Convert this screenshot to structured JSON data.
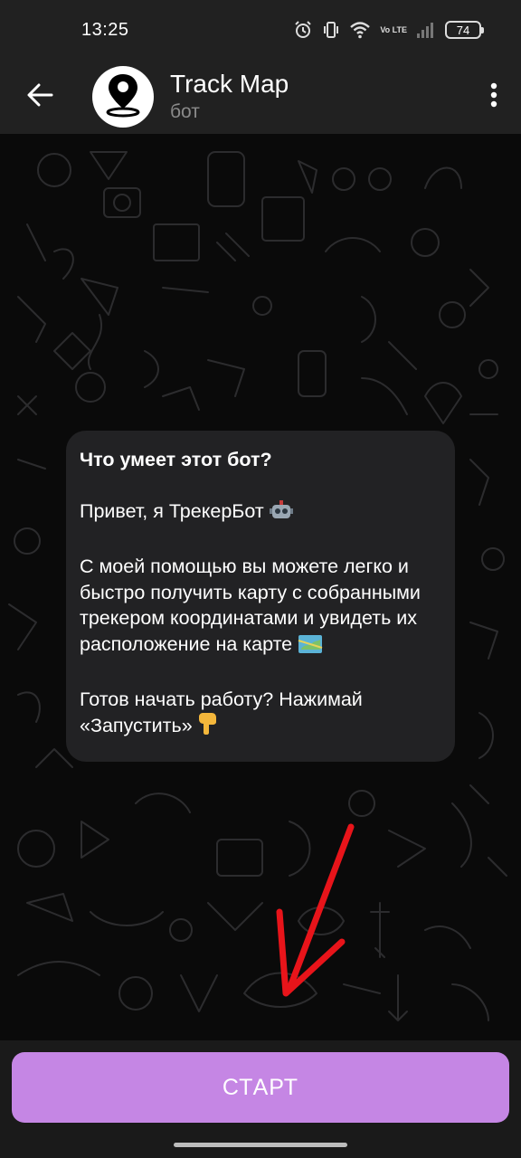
{
  "status_bar": {
    "time": "13:25",
    "battery": "74",
    "network": "Vo LTE",
    "icons": [
      "alarm-icon",
      "vibrate-icon",
      "wifi-icon",
      "volte-icon",
      "signal-icon",
      "battery-icon"
    ]
  },
  "header": {
    "title": "Track Map",
    "subtitle": "бот",
    "icons": [
      "back-arrow-icon",
      "map-pin-icon",
      "more-vert-icon"
    ]
  },
  "message": {
    "title": "Что умеет этот бот?",
    "greeting": "Привет, я ТрекерБот",
    "description": "С моей помощью вы можете легко и быстро получить карту с собранными трекером координатами и увидеть их расположение на карте",
    "cta": "Готов начать работу? Нажимай «Запустить»",
    "icons": [
      "robot-emoji",
      "map-emoji",
      "pointing-down-emoji"
    ]
  },
  "bottom": {
    "start_label": "СТАРТ"
  },
  "colors": {
    "bar_bg": "#212121",
    "bubble_bg": "#222224",
    "button_bg": "#c586e4",
    "annotation_arrow": "#e8141a"
  }
}
